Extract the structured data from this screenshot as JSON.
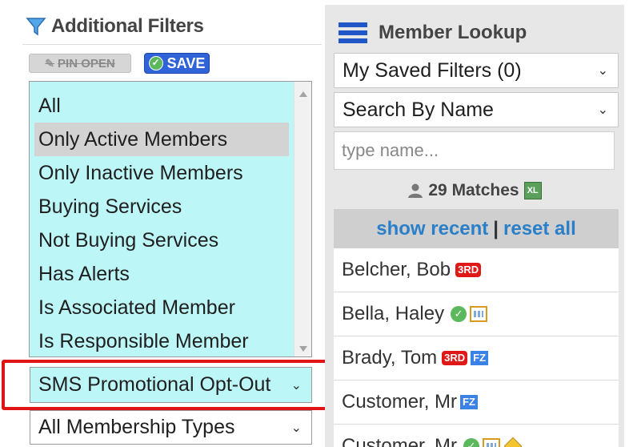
{
  "filters": {
    "title": "Additional Filters",
    "pin_label": "PIN OPEN",
    "save_label": "SAVE",
    "status_options": [
      "All",
      "Only Active Members",
      "Only Inactive Members",
      "Buying Services",
      "Not Buying Services",
      "Has Alerts",
      "Is Associated Member",
      "Is Responsible Member"
    ],
    "selected_status": "Only Active Members",
    "sms_select": "SMS Promotional Opt-Out",
    "membership_types_select": "All Membership Types",
    "list_bg_color": "#bdf6f6",
    "highlight_color": "#e01414"
  },
  "lookup": {
    "title": "Member Lookup",
    "saved_filters": "My Saved Filters (0)",
    "search_by": "Search By Name",
    "name_placeholder": "type name...",
    "matches": "29 Matches",
    "show_recent": "show recent",
    "separator": "|",
    "reset_all": "reset all",
    "members": [
      {
        "name": "Belcher, Bob",
        "badges": [
          "3RD"
        ]
      },
      {
        "name": "Bella, Haley",
        "badges": [
          "check",
          "calendar"
        ]
      },
      {
        "name": "Brady, Tom",
        "badges": [
          "3RD",
          "FZ"
        ]
      },
      {
        "name": "Customer, Mr",
        "badges": [
          "FZ"
        ]
      },
      {
        "name": "Customer, Mr",
        "badges": [
          "check",
          "calendar",
          "diamond"
        ]
      }
    ],
    "accent_color": "#2156c6",
    "link_color": "#2a7fc8"
  }
}
